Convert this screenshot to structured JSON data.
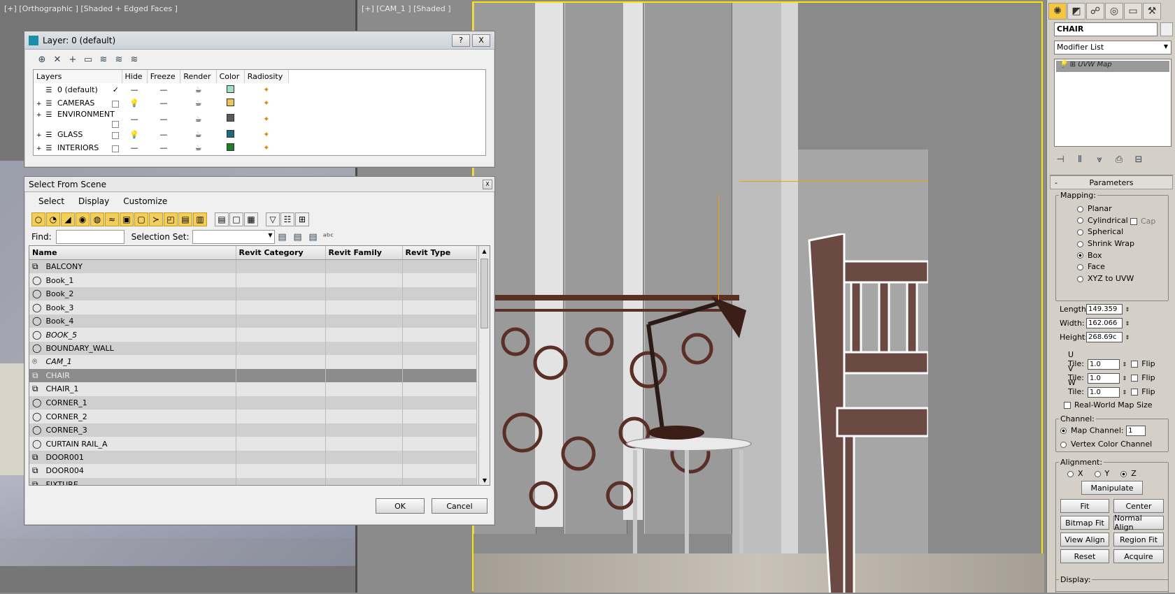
{
  "viewports": {
    "left_label": "[+] [Orthographic ] [Shaded + Edged Faces ]",
    "right_label": "[+] [CAM_1 ] [Shaded ]"
  },
  "layer_dialog": {
    "title": "Layer: 0 (default)",
    "help_btn": "?",
    "close_btn": "X",
    "columns": [
      "Layers",
      "Hide",
      "Freeze",
      "Render",
      "Color",
      "Radiosity"
    ],
    "rows": [
      {
        "expand": "",
        "name": "0 (default)",
        "check": "✓",
        "hide": "—",
        "freeze": "—",
        "color": "#9fe0c4"
      },
      {
        "expand": "+",
        "name": "CAMERAS",
        "check": "",
        "hide": "💡",
        "freeze": "—",
        "color": "#e8c45a"
      },
      {
        "expand": "+",
        "name": "ENVIRONMENT",
        "check": "",
        "hide": "—",
        "freeze": "—",
        "color": "#5a5a5a"
      },
      {
        "expand": "+",
        "name": "GLASS",
        "check": "",
        "hide": "💡",
        "freeze": "—",
        "color": "#1c6b80"
      },
      {
        "expand": "+",
        "name": "INTERIORS",
        "check": "",
        "hide": "—",
        "freeze": "—",
        "color": "#1f7d2c"
      }
    ]
  },
  "select_dialog": {
    "title": "Select From Scene",
    "close_btn": "X",
    "menu": [
      "Select",
      "Display",
      "Customize"
    ],
    "find_label": "Find:",
    "find_value": "",
    "selection_set_label": "Selection Set:",
    "selection_set_value": "",
    "columns": [
      "Name",
      "Revit Category",
      "Revit Family",
      "Revit Type"
    ],
    "objects": [
      {
        "name": "BALCONY",
        "icon": "group",
        "italic": false
      },
      {
        "name": "Book_1",
        "icon": "sphere",
        "italic": false
      },
      {
        "name": "Book_2",
        "icon": "sphere",
        "italic": false
      },
      {
        "name": "Book_3",
        "icon": "sphere",
        "italic": false
      },
      {
        "name": "Book_4",
        "icon": "sphere",
        "italic": false
      },
      {
        "name": "BOOK_5",
        "icon": "sphere",
        "italic": true
      },
      {
        "name": "BOUNDARY_WALL",
        "icon": "sphere",
        "italic": false
      },
      {
        "name": "CAM_1",
        "icon": "camera",
        "italic": true
      },
      {
        "name": "CHAIR",
        "icon": "group",
        "italic": false,
        "selected": true
      },
      {
        "name": "CHAIR_1",
        "icon": "group",
        "italic": false
      },
      {
        "name": "CORNER_1",
        "icon": "sphere",
        "italic": false
      },
      {
        "name": "CORNER_2",
        "icon": "sphere",
        "italic": false
      },
      {
        "name": "CORNER_3",
        "icon": "sphere",
        "italic": false
      },
      {
        "name": "CURTAIN RAIL_A",
        "icon": "sphere",
        "italic": false
      },
      {
        "name": "DOOR001",
        "icon": "group",
        "italic": false
      },
      {
        "name": "DOOR004",
        "icon": "group",
        "italic": false
      },
      {
        "name": "FIXTURE",
        "icon": "group",
        "italic": false
      }
    ],
    "ok_label": "OK",
    "cancel_label": "Cancel"
  },
  "command_panel": {
    "object_name": "CHAIR",
    "modifier_list": "Modifier List",
    "stack_item": "UVW Map",
    "rollout_title": "Parameters",
    "mapping_label": "Mapping:",
    "mapping_options": [
      "Planar",
      "Cylindrical",
      "Spherical",
      "Shrink Wrap",
      "Box",
      "Face",
      "XYZ to UVW"
    ],
    "mapping_selected": "Box",
    "cap_label": "Cap",
    "length_label": "Length:",
    "length_value": "149.359",
    "width_label": "Width:",
    "width_value": "162.066",
    "height_label": "Height:",
    "height_value": "268.69c",
    "utile_label": "U Tile:",
    "utile_value": "1.0",
    "vtile_label": "V Tile:",
    "vtile_value": "1.0",
    "wtile_label": "W Tile:",
    "wtile_value": "1.0",
    "flip_label": "Flip",
    "realworld_label": "Real-World Map Size",
    "channel_label": "Channel:",
    "map_channel_label": "Map Channel:",
    "map_channel_value": "1",
    "vertex_color_label": "Vertex Color Channel",
    "alignment_label": "Alignment:",
    "align_x": "X",
    "align_y": "Y",
    "align_z": "Z",
    "manipulate": "Manipulate",
    "fit": "Fit",
    "center": "Center",
    "bitmap_fit": "Bitmap Fit",
    "normal_align": "Normal Align",
    "view_align": "View Align",
    "region_fit": "Region Fit",
    "reset": "Reset",
    "acquire": "Acquire",
    "display_label": "Display:",
    "collapse": "-"
  }
}
